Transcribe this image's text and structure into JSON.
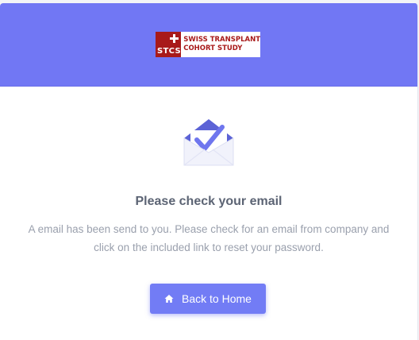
{
  "logo": {
    "abbr": "STCS",
    "line1": "SWISS TRANSPLANT",
    "line2": "COHORT STUDY"
  },
  "main": {
    "title": "Please check your email",
    "description": "A email has been send to you. Please check for an email from company and click on the included link to reset your password."
  },
  "actions": {
    "back_home_label": "Back to Home",
    "back_home_icon": "home-icon"
  },
  "colors": {
    "header": "#7177f4",
    "primary": "#727cf5",
    "brand_red": "#a81a1a"
  }
}
